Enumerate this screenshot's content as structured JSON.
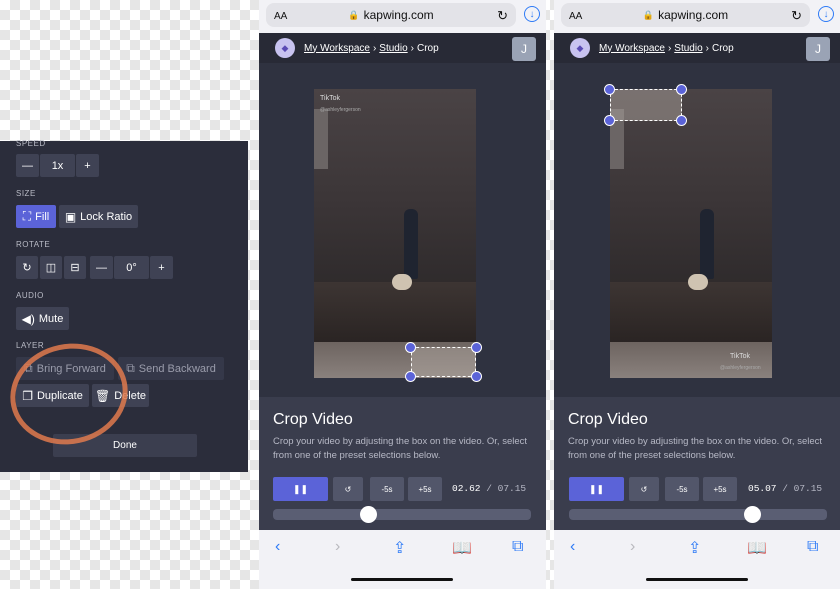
{
  "left_panel": {
    "speed_label": "SPEED",
    "speed_value": "1x",
    "size_label": "SIZE",
    "fill_label": "Fill",
    "lock_ratio_label": "Lock Ratio",
    "rotate_label": "ROTATE",
    "rotate_value": "0°",
    "audio_label": "AUDIO",
    "mute_label": "Mute",
    "layer_label": "LAYER",
    "bring_forward_label": "Bring Forward",
    "send_backward_label": "Send Backward",
    "duplicate_label": "Duplicate",
    "delete_label": "Delete",
    "done_label": "Done"
  },
  "browser": {
    "text_size": "AA",
    "url": "kapwing.com"
  },
  "breadcrumb": {
    "workspace": "My Workspace",
    "studio": "Studio",
    "current": "Crop",
    "separator": "›"
  },
  "user_initial": "J",
  "video": {
    "watermark": "TikTok",
    "handle": "@ashleyfergerson"
  },
  "crop_panel": {
    "title": "Crop Video",
    "description": "Crop your video by adjusting the box on the video. Or, select from one of the preset selections below.",
    "back_label": "-5s",
    "forward_label": "+5s",
    "total_time": "07.15",
    "time_separator": "/"
  },
  "phones": [
    {
      "current_time": "02.62",
      "progress": 0.37
    },
    {
      "current_time": "05.07",
      "progress": 0.71
    }
  ],
  "accent_color": "#5b63d8",
  "highlight_color": "#e07a4e"
}
